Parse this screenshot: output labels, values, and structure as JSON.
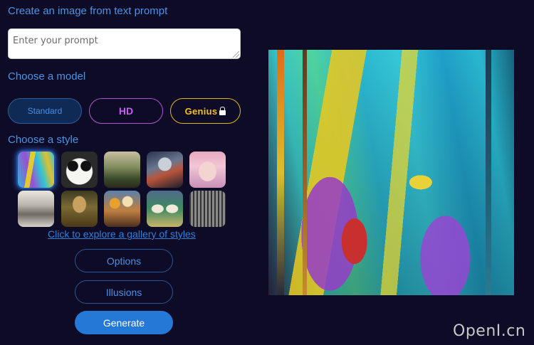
{
  "headings": {
    "create": "Create an image from text prompt",
    "model": "Choose a model",
    "style": "Choose a style"
  },
  "prompt": {
    "placeholder": "Enter your prompt",
    "value": ""
  },
  "models": {
    "standard": "Standard",
    "hd": "HD",
    "genius": "Genius",
    "genius_icon": "lock-icon",
    "selected": "Standard"
  },
  "styles": {
    "thumbnails": [
      {
        "name": "abstract-painting",
        "selected": true
      },
      {
        "name": "panda"
      },
      {
        "name": "landscape-painting"
      },
      {
        "name": "robot-warrior"
      },
      {
        "name": "anime-girl"
      },
      {
        "name": "sketch-vintage-car"
      },
      {
        "name": "mona-lisa"
      },
      {
        "name": "flower-still-life"
      },
      {
        "name": "ballet-dancers"
      },
      {
        "name": "pencil-city"
      }
    ],
    "explore_link": "Click to explore a gallery of styles"
  },
  "actions": {
    "options": "Options",
    "illusions": "Illusions",
    "generate": "Generate"
  },
  "watermark": "OpenI.cn",
  "colors": {
    "background": "#0e0b26",
    "accent": "#2478d6",
    "heading": "#4b93e4",
    "hd": "#c95cf0",
    "genius": "#f2c21a"
  }
}
